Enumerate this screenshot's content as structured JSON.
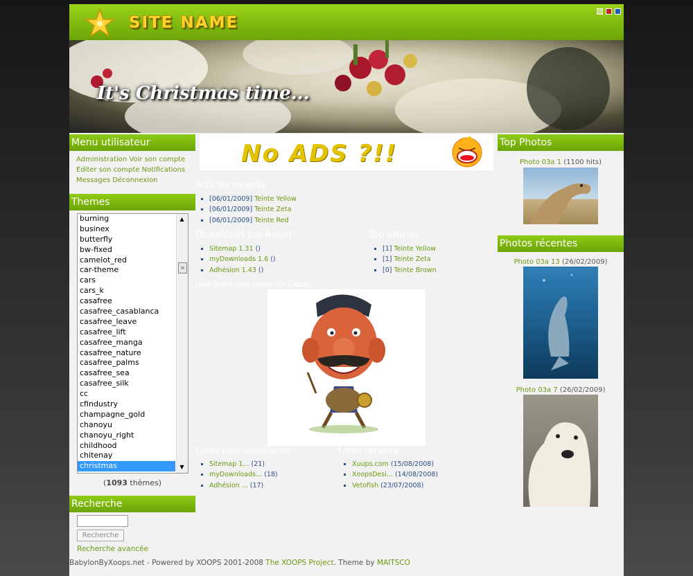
{
  "header": {
    "site_name": "SITE NAME",
    "swatches": [
      "#c8e07a",
      "#cc1f1f",
      "#1f5fb0"
    ]
  },
  "banner": {
    "tagline": "It's Christmas time..."
  },
  "ads": {
    "text": "No ADS ?!!"
  },
  "user_menu": {
    "title": "Menu utilisateur",
    "items": [
      "Administration",
      "Voir son compte",
      "Editer son compte",
      "Notifications",
      "Messages",
      "Déconnexion"
    ]
  },
  "themes": {
    "title": "Themes",
    "list": [
      "burning",
      "businex",
      "butterfly",
      "bw-fixed",
      "camelot_red",
      "car-theme",
      "cars",
      "cars_k",
      "casafree",
      "casafree_casablanca",
      "casafree_leave",
      "casafree_lift",
      "casafree_manga",
      "casafree_nature",
      "casafree_palms",
      "casafree_sea",
      "casafree_silk",
      "cc",
      "cfindustry",
      "champagne_gold",
      "chanoyu",
      "chanoyu_right",
      "childhood",
      "chitenay",
      "christmas"
    ],
    "selected": "christmas",
    "count": "1093",
    "count_label": "thèmes"
  },
  "search": {
    "title": "Recherche",
    "button": "Recherche",
    "advanced": "Recherche avancée",
    "value": ""
  },
  "recent_articles": {
    "title": "Articles récents",
    "items": [
      {
        "date": "[06/01/2009]",
        "title": "Teinte Yellow"
      },
      {
        "date": "[06/01/2009]",
        "title": "Teinte Zeta"
      },
      {
        "date": "[06/01/2009]",
        "title": "Teinte Red"
      }
    ]
  },
  "downloads_top": {
    "title": "Downloads top Rated",
    "items": [
      {
        "name": "Sitemap 1.31",
        "extra": "()"
      },
      {
        "name": "myDownloads 1.6",
        "extra": "()"
      },
      {
        "name": "Adhésion 1.43",
        "extra": "()"
      }
    ]
  },
  "top_articles": {
    "title": "Top articles",
    "items": [
      {
        "rank": "[1]",
        "title": "Teinte Yellow"
      },
      {
        "rank": "[1]",
        "title": "Teinte Zeta"
      },
      {
        "rank": "[0]",
        "title": "Teinte Brown"
      }
    ]
  },
  "cartoon": {
    "title": "Joke Boxe (par Jewel for Gabo)"
  },
  "popular_links": {
    "title": "Liens plus populaires",
    "items": [
      {
        "name": "Sitemap 1...",
        "count": "(21)"
      },
      {
        "name": "myDownloads...",
        "count": "(18)"
      },
      {
        "name": "Adhésion ...",
        "count": "(17)"
      }
    ]
  },
  "recent_links": {
    "title": "Liens récents",
    "items": [
      {
        "name": "Xuups.com",
        "date": "(15/08/2008)"
      },
      {
        "name": "XoopsDesi...",
        "date": "(14/08/2008)"
      },
      {
        "name": "Vetofish",
        "date": "(23/07/2008)"
      }
    ]
  },
  "top_photos": {
    "title": "Top Photos",
    "items": [
      {
        "name": "Photo 03a 1",
        "info": "(1100 hits)"
      }
    ]
  },
  "recent_photos": {
    "title": "Photos récentes",
    "items": [
      {
        "name": "Photo 03a 13",
        "info": "(26/02/2009)"
      },
      {
        "name": "Photo 03a 7",
        "info": "(26/02/2009)"
      }
    ]
  },
  "footer": {
    "text": "BabylonByXoops.net - Powered by XOOPS 2001-2008",
    "project": "The XOOPS Project",
    "theme_by": ". Theme by",
    "author": "MAITSCO"
  }
}
